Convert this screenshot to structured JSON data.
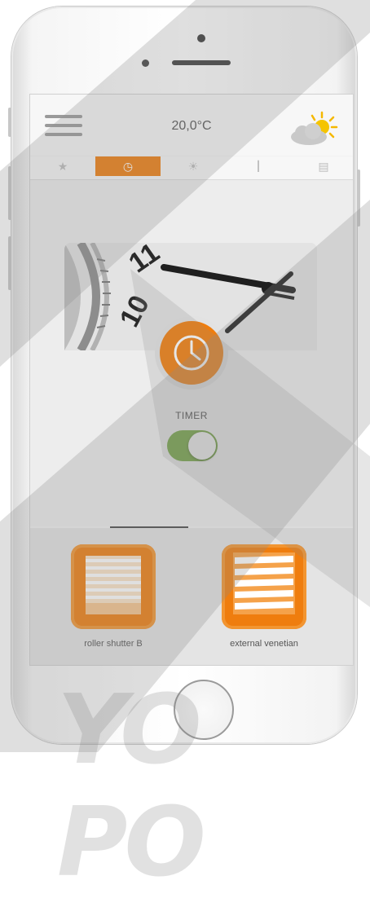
{
  "topbar": {
    "temperature": "20,0°C",
    "menu_icon": "hamburger-menu-icon",
    "weather_icon": "sun-behind-cloud-icon"
  },
  "tabs": [
    {
      "icon": "star-icon",
      "glyph": "★",
      "active": false
    },
    {
      "icon": "clock-icon",
      "glyph": "◷",
      "active": true
    },
    {
      "icon": "sun-icon",
      "glyph": "☀",
      "active": false
    },
    {
      "icon": "thermometer-icon",
      "glyph": "🌡",
      "active": false
    },
    {
      "icon": "shutter-icon",
      "glyph": "▤",
      "active": false
    }
  ],
  "timer": {
    "label": "TIMER",
    "enabled": true,
    "badge_icon": "clock-icon"
  },
  "clock_banner": {
    "numerals": [
      "11",
      "10"
    ]
  },
  "devices": [
    {
      "label": "roller shutter B",
      "icon": "roller-shutter-icon"
    },
    {
      "label": "external venetian",
      "icon": "venetian-blind-icon"
    }
  ],
  "colors": {
    "accent": "#ef7d0e",
    "toggle_on": "#6fa53a",
    "screen_bg": "#ededed"
  },
  "watermark": "YO PO"
}
